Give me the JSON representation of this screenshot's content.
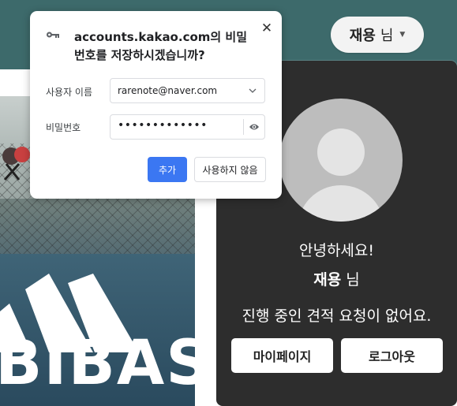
{
  "header": {
    "user_name": "재용",
    "user_suffix": "님",
    "caret_icon": "chevron-down-icon"
  },
  "background": {
    "logo_text": "BIBAS"
  },
  "panel": {
    "greeting": "안녕하세요!",
    "username": "재용",
    "username_suffix": "님",
    "status": "진행 중인 견적 요청이 없어요.",
    "mypage_label": "마이페이지",
    "logout_label": "로그아웃"
  },
  "password_dialog": {
    "title_line1": "accounts.kakao.com의 비밀",
    "title_line2": "번호를 저장하시겠습니까?",
    "username_label": "사용자 이름",
    "username_value": "rarenote@naver.com",
    "password_label": "비밀번호",
    "password_value": "•••••••••••••",
    "add_label": "추가",
    "never_label": "사용하지 않음",
    "icons": [
      "key-icon",
      "close-icon",
      "chevron-down-icon",
      "eye-icon"
    ],
    "accent_color": "#3b77f2"
  },
  "colors": {
    "header": "#3d6a6b",
    "panel": "#2d2d2d"
  }
}
